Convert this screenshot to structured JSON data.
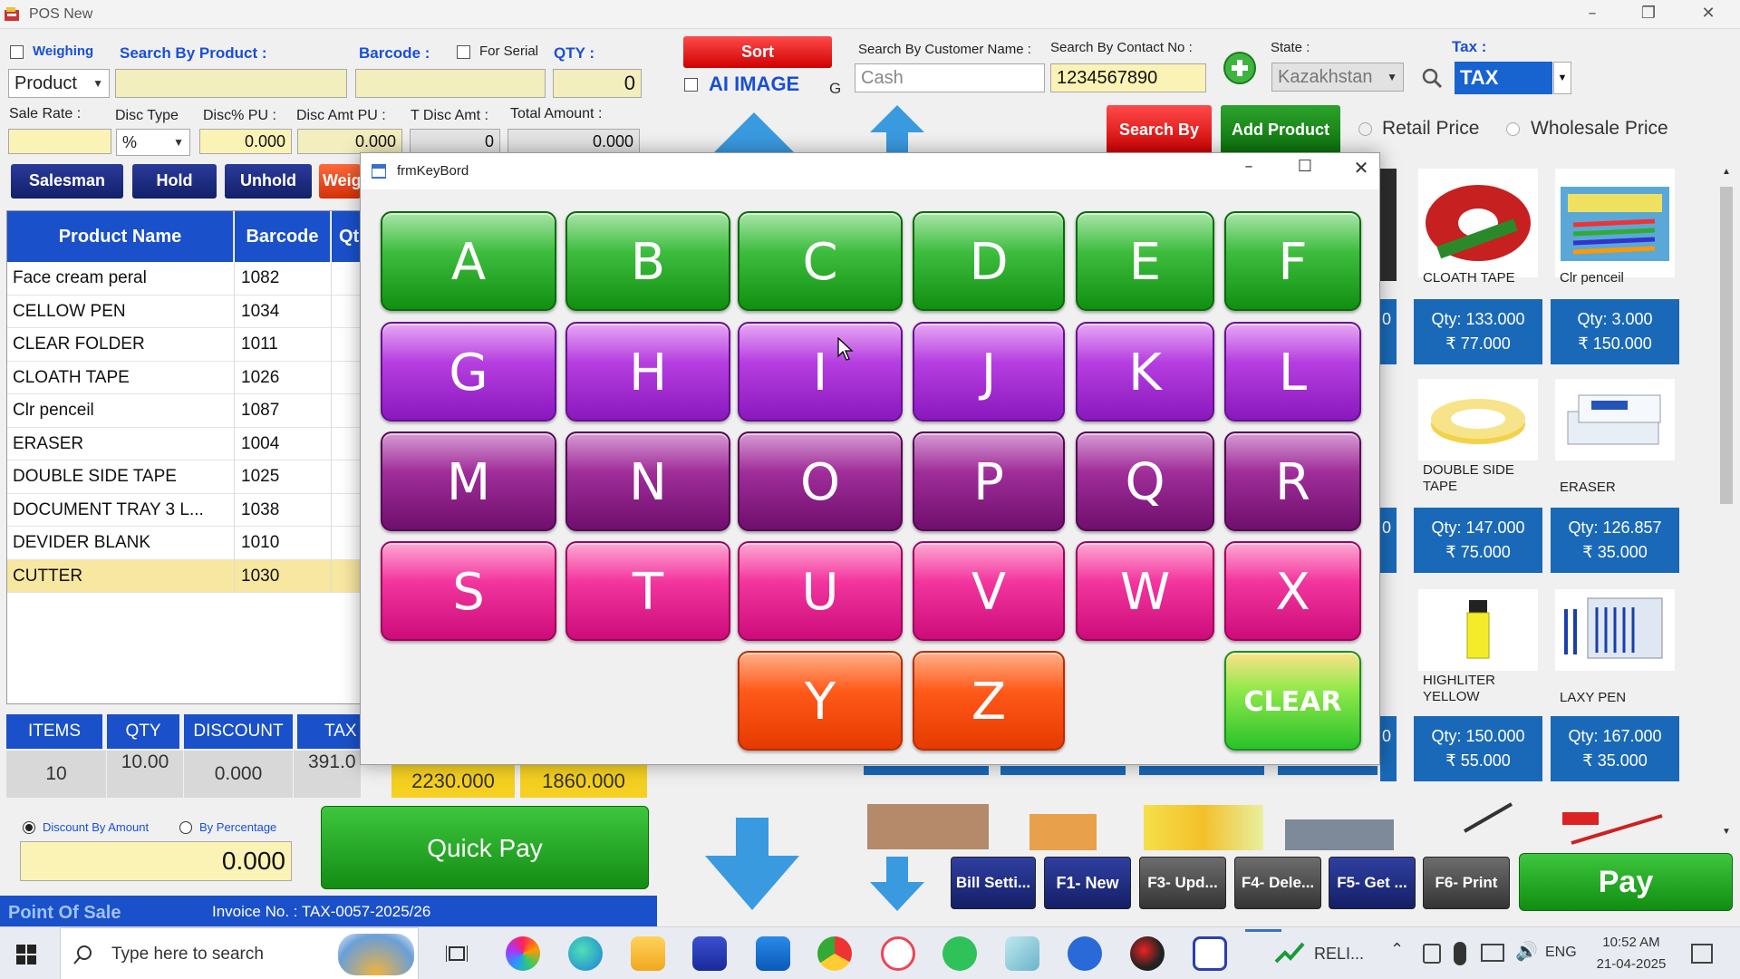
{
  "window": {
    "title": "POS New",
    "controls": [
      "–",
      "❐",
      "✕"
    ]
  },
  "top_form": {
    "weighing_label": "Weighing",
    "search_by_product_label": "Search By Product :",
    "barcode_label": "Barcode :",
    "for_serial_label": "For Serial",
    "qty_label": "QTY :",
    "qty_value": "0",
    "product_select": "Product",
    "sort_button": "Sort",
    "ai_image_label": "AI IMAGE",
    "g_label": "G",
    "customer_name_label": "Search By Customer Name :",
    "customer_name_value": "Cash",
    "contact_no_label": "Search By Contact No :",
    "contact_no_value": "1234567890",
    "state_label": "State :",
    "state_value": "Kazakhstan",
    "tax_label": "Tax :",
    "tax_value": "TAX",
    "sale_rate_label": "Sale Rate :",
    "disc_type_label": "Disc Type",
    "disc_type_value": "%",
    "disc_pu_label": "Disc% PU :",
    "disc_pu_value": "0.000",
    "disc_amt_pu_label": "Disc Amt PU :",
    "disc_amt_pu_value": "0.000",
    "t_disc_amt_label": "T Disc Amt :",
    "t_disc_amt_value": "0",
    "total_amount_label": "Total Amount :",
    "total_amount_value": "0.000",
    "search_by_button": "Search By",
    "add_product_button": "Add Product",
    "retail_price_label": "Retail Price",
    "wholesale_price_label": "Wholesale Price"
  },
  "action_buttons": [
    "Salesman",
    "Hold",
    "Unhold",
    "Weig"
  ],
  "grid": {
    "headers": [
      "Product Name",
      "Barcode",
      "Qt"
    ],
    "rows": [
      {
        "name": "Face cream peral",
        "barcode": "1082"
      },
      {
        "name": "CELLOW PEN",
        "barcode": "1034"
      },
      {
        "name": "CLEAR FOLDER",
        "barcode": "1011"
      },
      {
        "name": "CLOATH TAPE",
        "barcode": "1026"
      },
      {
        "name": "Clr penceil",
        "barcode": "1087"
      },
      {
        "name": "ERASER",
        "barcode": "1004"
      },
      {
        "name": "DOUBLE SIDE TAPE",
        "barcode": "1025"
      },
      {
        "name": "DOCUMENT TRAY 3 L...",
        "barcode": "1038"
      },
      {
        "name": "DEVIDER BLANK",
        "barcode": "1010"
      },
      {
        "name": "CUTTER",
        "barcode": "1030"
      }
    ]
  },
  "summary": {
    "headers": [
      "ITEMS",
      "QTY",
      "DISCOUNT",
      "TAX"
    ],
    "values": [
      "10",
      "10.00",
      "0.000",
      "391.0"
    ],
    "total1": "2230.000",
    "total2": "1860.000"
  },
  "discount": {
    "by_amount_label": "Discount By Amount",
    "by_percentage_label": "By Percentage",
    "value": "0.000"
  },
  "quick_pay_button": "Quick Pay",
  "status": {
    "title": "Point Of Sale",
    "invoice": "Invoice No. : TAX-0057-2025/26"
  },
  "keyboard": {
    "title": "frmKeyBord",
    "keys_row1": [
      "A",
      "B",
      "C",
      "D",
      "E",
      "F"
    ],
    "keys_row2": [
      "G",
      "H",
      "I",
      "J",
      "K",
      "L"
    ],
    "keys_row3": [
      "M",
      "N",
      "O",
      "P",
      "Q",
      "R"
    ],
    "keys_row4": [
      "S",
      "T",
      "U",
      "V",
      "W",
      "X"
    ],
    "keys_row5": [
      "Y",
      "Z"
    ],
    "clear": "CLEAR"
  },
  "products": [
    {
      "name": "CLOATH TAPE",
      "qty": "Qty: 133.000",
      "price": "₹ 77.000"
    },
    {
      "name": "Clr penceil",
      "qty": "Qty: 3.000",
      "price": "₹ 150.000"
    },
    {
      "name": "DOUBLE SIDE TAPE",
      "qty": "Qty: 147.000",
      "price": "₹ 75.000"
    },
    {
      "name": "ERASER",
      "qty": "Qty: 126.857",
      "price": "₹ 35.000"
    },
    {
      "name": "HIGHLITER YELLOW",
      "qty": "Qty: 150.000",
      "price": "₹ 55.000"
    },
    {
      "name": "LAXY PEN",
      "qty": "Qty: 167.000",
      "price": "₹ 35.000"
    }
  ],
  "bottom_buttons": [
    "Bill Setti...",
    "F1- New",
    "F3- Upd...",
    "F4- Dele...",
    "F5- Get ...",
    "F6- Print"
  ],
  "pay_button": "Pay",
  "taskbar": {
    "search_placeholder": "Type here to search",
    "tray_app": "RELI...",
    "lang": "ENG",
    "time": "10:52 AM",
    "date": "21-04-2025"
  },
  "colors": {
    "accent_blue": "#1a50c9",
    "navy": "#13206a",
    "sort_red": "#e51b1b",
    "pay_green": "#14a014"
  }
}
